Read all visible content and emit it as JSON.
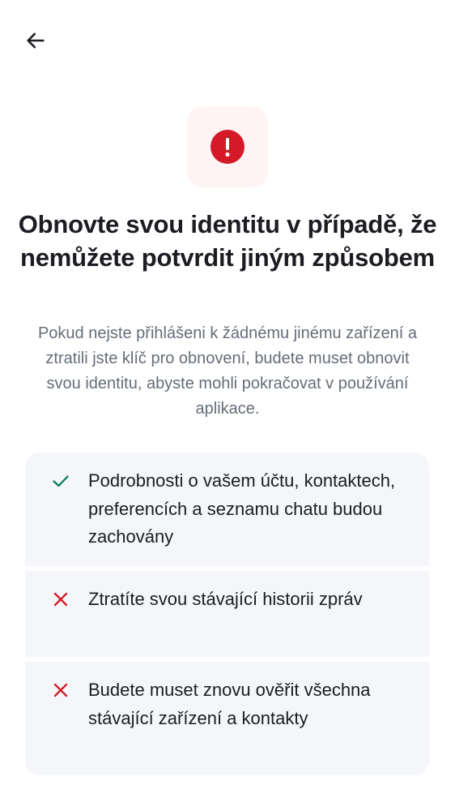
{
  "header": {
    "back_icon": "arrow-left-icon"
  },
  "hero": {
    "icon": "alert-circle-icon",
    "icon_color": "#d51928",
    "tile_color": "#fff4f3"
  },
  "title": "Obnovte svou identitu v případě, že nemůžete potvrdit jiným způsobem",
  "subtitle": "Pokud nejste přihlášeni k žádnému jinému zařízení a ztratili jste klíč pro obnovení, budete muset obnovit svou identitu, abyste mohli pokračovat v používání aplikace.",
  "consequences": [
    {
      "icon": "check-icon",
      "icon_color": "#0b7e5b",
      "text": "Podrobnosti o vašem účtu, kontaktech, preferencích a seznamu chatu budou zachovány"
    },
    {
      "icon": "close-icon",
      "icon_color": "#d51928",
      "text": "Ztratíte svou stávající historii zpráv"
    },
    {
      "icon": "close-icon",
      "icon_color": "#d51928",
      "text": "Budete muset znovu ověřit všechna stávající zařízení a kontakty"
    }
  ]
}
